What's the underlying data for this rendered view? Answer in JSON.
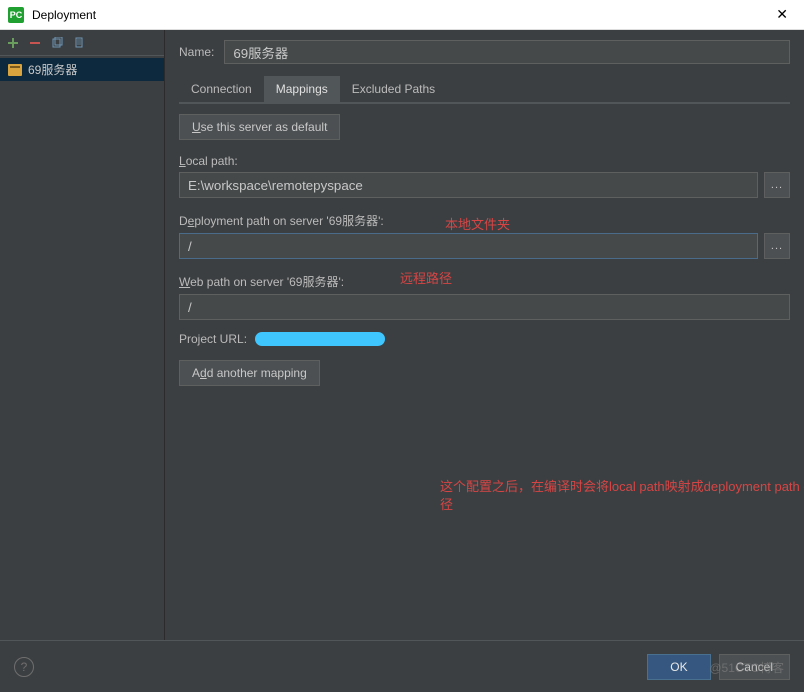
{
  "window": {
    "title": "Deployment",
    "close": "✕"
  },
  "toolbar": {
    "add": "+",
    "remove": "−",
    "copy": "⎘",
    "edit": "≡"
  },
  "sidebar": {
    "items": [
      {
        "label": "69服务器"
      }
    ]
  },
  "form": {
    "name_label": "Name:",
    "name_value": "69服务器",
    "tabs": {
      "connection": "Connection",
      "mappings": "Mappings",
      "excluded": "Excluded Paths"
    },
    "use_default_btn": "Use this server as default",
    "local_path_label": "Local path:",
    "local_path_value": "E:\\workspace\\remotepyspace",
    "deploy_path_label": "Deployment path on server '69服务器':",
    "deploy_path_value": "/",
    "web_path_label": "Web path on server '69服务器':",
    "web_path_value": "/",
    "project_url_label": "Project URL:",
    "add_mapping_btn": "Add another mapping",
    "browse": "..."
  },
  "annotations": {
    "local_folder": "本地文件夹",
    "remote_path": "远程路径",
    "explain": "这个配置之后，在编译时会将local path映射成deployment path on server指定的路径"
  },
  "footer": {
    "help": "?",
    "ok": "OK",
    "cancel": "Cancel"
  },
  "watermark": "@51CTO博客"
}
